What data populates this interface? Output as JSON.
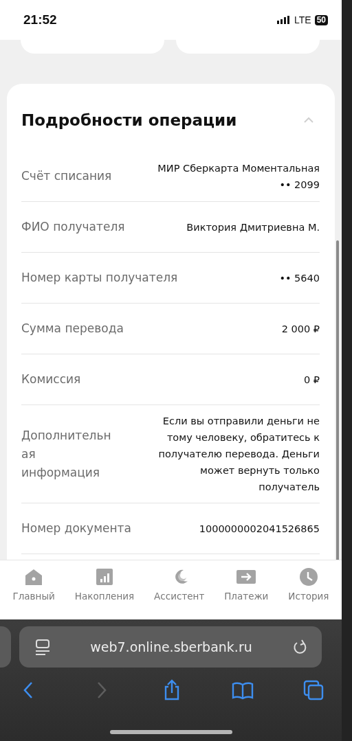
{
  "status_bar": {
    "time": "21:52",
    "network": "LTE",
    "battery": "50"
  },
  "details": {
    "title": "Подробности операции",
    "expanded": true,
    "rows": [
      {
        "label": "Счёт списания",
        "value": "МИР Сберкарта Моментальная •• 2099"
      },
      {
        "label": "ФИО получателя",
        "value": "Виктория Дмитриевна М."
      },
      {
        "label": "Номер карты получателя",
        "value": "•• 5640"
      },
      {
        "label": "Сумма перевода",
        "value": "2 000 ₽"
      },
      {
        "label": "Комиссия",
        "value": "0 ₽"
      },
      {
        "label": "Дополнительная информация",
        "value": "Если вы отправили деньги не тому человеку, обратитесь к получателю перевода. Деньги может вернуть только получатель"
      },
      {
        "label": "Номер документа",
        "value": "1000000002041526865"
      }
    ]
  },
  "tab_bar": [
    {
      "label": "Главный",
      "selected": false
    },
    {
      "label": "Накопления",
      "selected": false
    },
    {
      "label": "Ассистент",
      "selected": false
    },
    {
      "label": "Платежи",
      "selected": false
    },
    {
      "label": "История",
      "selected": false
    }
  ],
  "browser": {
    "url": "web7.online.sberbank.ru",
    "toolbar": [
      {
        "kind": "back",
        "disabled": false
      },
      {
        "kind": "forward",
        "disabled": true
      },
      {
        "kind": "share",
        "disabled": false
      },
      {
        "kind": "bookmarks",
        "disabled": false
      },
      {
        "kind": "tabs",
        "disabled": false
      }
    ]
  }
}
